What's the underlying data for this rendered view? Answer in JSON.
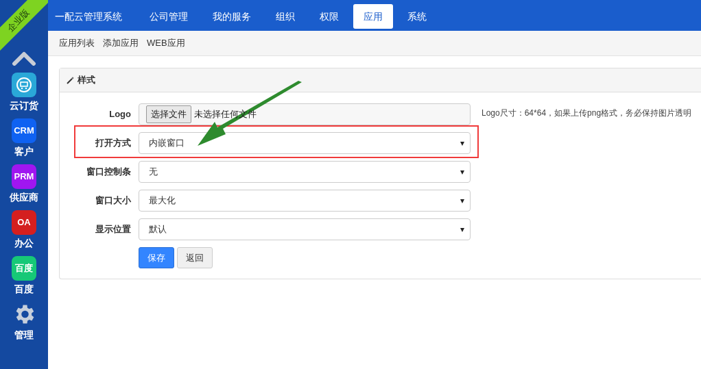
{
  "sidebar": {
    "ribbon": "企业版",
    "items": [
      {
        "kind": "cart",
        "label": "云订货",
        "color": "#2aa8d8"
      },
      {
        "kind": "text",
        "icon_text": "CRM",
        "label": "客户",
        "color": "#0f62f2"
      },
      {
        "kind": "text",
        "icon_text": "PRM",
        "label": "供应商",
        "color": "#a016f0"
      },
      {
        "kind": "text",
        "icon_text": "OA",
        "label": "办公",
        "color": "#d41f1f"
      },
      {
        "kind": "text",
        "icon_text": "百度",
        "label": "百度",
        "color": "#16c877"
      },
      {
        "kind": "gear",
        "label": "管理",
        "color": "#c6cfdc"
      }
    ]
  },
  "nav": {
    "brand": "一配云管理系统",
    "tabs": [
      {
        "label": "公司管理",
        "selected": false
      },
      {
        "label": "我的服务",
        "selected": false
      },
      {
        "label": "组织",
        "selected": false
      },
      {
        "label": "权限",
        "selected": false
      },
      {
        "label": "应用",
        "selected": true
      },
      {
        "label": "系统",
        "selected": false
      }
    ]
  },
  "subnav": [
    "应用列表",
    "添加应用",
    "WEB应用"
  ],
  "panel": {
    "title": "样式",
    "rows": [
      {
        "kind": "file",
        "label": "Logo",
        "button": "选择文件",
        "value": "未选择任何文件",
        "hint": "Logo尺寸：64*64，如果上传png格式，务必保持图片透明",
        "highlighted": false
      },
      {
        "kind": "select",
        "label": "打开方式",
        "value": "内嵌窗口",
        "highlighted": true
      },
      {
        "kind": "select",
        "label": "窗口控制条",
        "value": "无",
        "highlighted": false
      },
      {
        "kind": "select",
        "label": "窗口大小",
        "value": "最大化",
        "highlighted": false
      },
      {
        "kind": "select",
        "label": "显示位置",
        "value": "默认",
        "highlighted": false
      }
    ],
    "buttons": [
      {
        "kind": "primary",
        "label": "保存"
      },
      {
        "kind": "default",
        "label": "返回"
      }
    ],
    "caret": "▾"
  }
}
